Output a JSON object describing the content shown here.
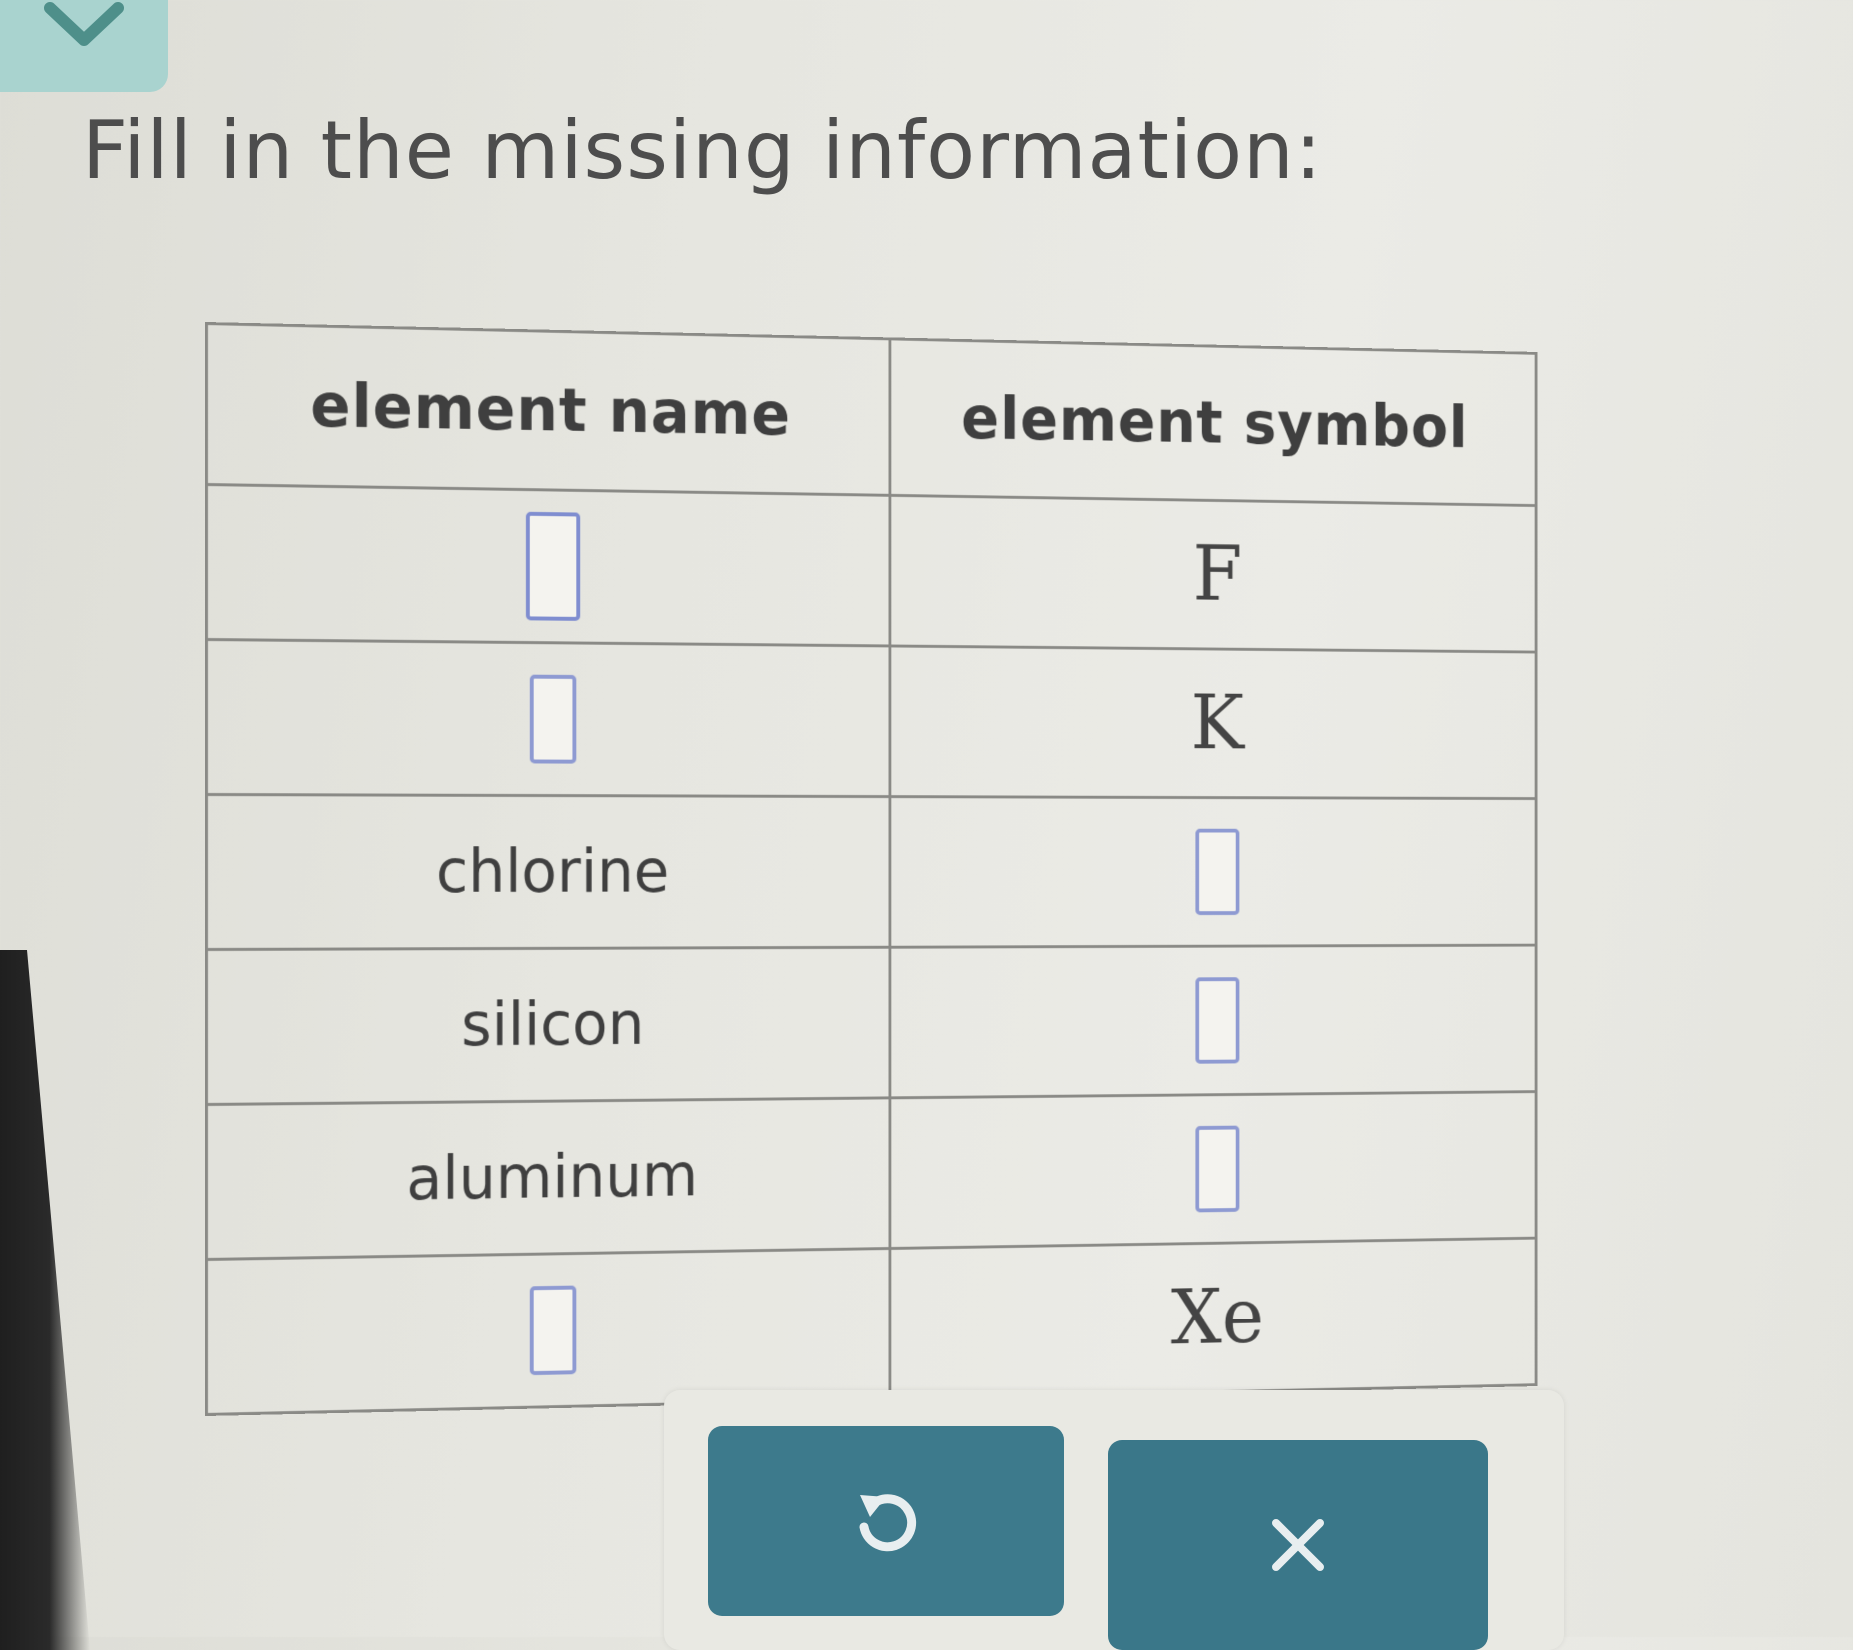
{
  "prompt": "Fill in the missing information:",
  "table": {
    "headers": {
      "name": "element name",
      "symbol": "element symbol"
    },
    "rows": [
      {
        "name": "",
        "symbol": "F"
      },
      {
        "name": "",
        "symbol": "K"
      },
      {
        "name": "chlorine",
        "symbol": ""
      },
      {
        "name": "silicon",
        "symbol": ""
      },
      {
        "name": "aluminum",
        "symbol": ""
      },
      {
        "name": "",
        "symbol": "Xe"
      }
    ]
  },
  "actions": {
    "undo_icon": "undo-icon",
    "clear_icon": "close-icon"
  },
  "colors": {
    "collapse_tab": "#a9d3cf",
    "button": "#3d7a8c",
    "input_border": "#8e9ad2"
  },
  "icons": {
    "collapse": "chevron-down-icon"
  }
}
